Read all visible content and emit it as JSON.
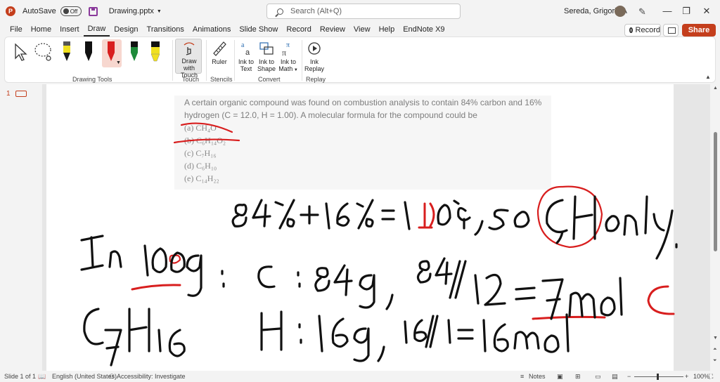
{
  "titlebar": {
    "autosave_label": "AutoSave",
    "autosave_state": "Off",
    "document_name": "Drawing.pptx",
    "search_placeholder": "Search (Alt+Q)",
    "user_name": "Sereda, Grigoriy A"
  },
  "menu": {
    "tabs": [
      "File",
      "Home",
      "Insert",
      "Draw",
      "Design",
      "Transitions",
      "Animations",
      "Slide Show",
      "Record",
      "Review",
      "View",
      "Help",
      "EndNote X9"
    ],
    "active_tab": "Draw",
    "record_label": "Record",
    "share_label": "Share"
  },
  "ribbon": {
    "groups": {
      "drawing_tools": "Drawing Tools",
      "touch": "Touch",
      "stencils": "Stencils",
      "convert": "Convert",
      "replay": "Replay"
    },
    "buttons": {
      "draw_with_touch": [
        "Draw with",
        "Touch"
      ],
      "ruler": "Ruler",
      "ink_to_text": [
        "Ink to",
        "Text"
      ],
      "ink_to_shape": [
        "Ink to",
        "Shape"
      ],
      "ink_to_math": [
        "Ink to",
        "Math"
      ],
      "ink_replay": [
        "Ink",
        "Replay"
      ]
    },
    "pen_colors": [
      "#1a1a1a",
      "#111111",
      "#d81e1e",
      "#1e8a3a",
      "#f0e020"
    ]
  },
  "slide": {
    "number": "1",
    "question_line1": "A certain organic compound was found on combustion analysis to contain 84% carbon and 16%",
    "question_line2": "hydrogen (C = 12.0, H = 1.00). A molecular formula for the compound could be",
    "options": [
      "(a) CH₄O",
      "(b) C₆H₁₄O₂",
      "(c) C₇H₁₆",
      "(d) C₆H₁₀",
      "(e) C₁₄H₂₂"
    ]
  },
  "status": {
    "slide_info": "Slide 1 of 1",
    "language": "English (United States)",
    "accessibility": "Accessibility: Investigate",
    "notes_label": "Notes",
    "zoom": "100%"
  },
  "colors": {
    "accent": "#c43e1c",
    "ink_red": "#d81e1e",
    "ink_black": "#111111"
  }
}
